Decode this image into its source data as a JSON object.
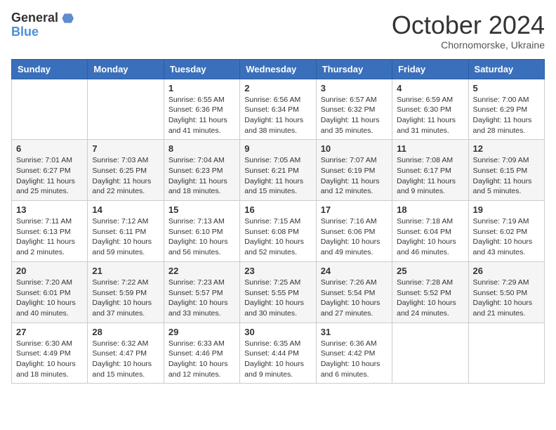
{
  "header": {
    "logo_general": "General",
    "logo_blue": "Blue",
    "month": "October 2024",
    "location": "Chornomorske, Ukraine"
  },
  "weekdays": [
    "Sunday",
    "Monday",
    "Tuesday",
    "Wednesday",
    "Thursday",
    "Friday",
    "Saturday"
  ],
  "weeks": [
    [
      null,
      null,
      {
        "day": "1",
        "sunrise": "6:55 AM",
        "sunset": "6:36 PM",
        "daylight": "11 hours and 41 minutes."
      },
      {
        "day": "2",
        "sunrise": "6:56 AM",
        "sunset": "6:34 PM",
        "daylight": "11 hours and 38 minutes."
      },
      {
        "day": "3",
        "sunrise": "6:57 AM",
        "sunset": "6:32 PM",
        "daylight": "11 hours and 35 minutes."
      },
      {
        "day": "4",
        "sunrise": "6:59 AM",
        "sunset": "6:30 PM",
        "daylight": "11 hours and 31 minutes."
      },
      {
        "day": "5",
        "sunrise": "7:00 AM",
        "sunset": "6:29 PM",
        "daylight": "11 hours and 28 minutes."
      }
    ],
    [
      {
        "day": "6",
        "sunrise": "7:01 AM",
        "sunset": "6:27 PM",
        "daylight": "11 hours and 25 minutes."
      },
      {
        "day": "7",
        "sunrise": "7:03 AM",
        "sunset": "6:25 PM",
        "daylight": "11 hours and 22 minutes."
      },
      {
        "day": "8",
        "sunrise": "7:04 AM",
        "sunset": "6:23 PM",
        "daylight": "11 hours and 18 minutes."
      },
      {
        "day": "9",
        "sunrise": "7:05 AM",
        "sunset": "6:21 PM",
        "daylight": "11 hours and 15 minutes."
      },
      {
        "day": "10",
        "sunrise": "7:07 AM",
        "sunset": "6:19 PM",
        "daylight": "11 hours and 12 minutes."
      },
      {
        "day": "11",
        "sunrise": "7:08 AM",
        "sunset": "6:17 PM",
        "daylight": "11 hours and 9 minutes."
      },
      {
        "day": "12",
        "sunrise": "7:09 AM",
        "sunset": "6:15 PM",
        "daylight": "11 hours and 5 minutes."
      }
    ],
    [
      {
        "day": "13",
        "sunrise": "7:11 AM",
        "sunset": "6:13 PM",
        "daylight": "11 hours and 2 minutes."
      },
      {
        "day": "14",
        "sunrise": "7:12 AM",
        "sunset": "6:11 PM",
        "daylight": "10 hours and 59 minutes."
      },
      {
        "day": "15",
        "sunrise": "7:13 AM",
        "sunset": "6:10 PM",
        "daylight": "10 hours and 56 minutes."
      },
      {
        "day": "16",
        "sunrise": "7:15 AM",
        "sunset": "6:08 PM",
        "daylight": "10 hours and 52 minutes."
      },
      {
        "day": "17",
        "sunrise": "7:16 AM",
        "sunset": "6:06 PM",
        "daylight": "10 hours and 49 minutes."
      },
      {
        "day": "18",
        "sunrise": "7:18 AM",
        "sunset": "6:04 PM",
        "daylight": "10 hours and 46 minutes."
      },
      {
        "day": "19",
        "sunrise": "7:19 AM",
        "sunset": "6:02 PM",
        "daylight": "10 hours and 43 minutes."
      }
    ],
    [
      {
        "day": "20",
        "sunrise": "7:20 AM",
        "sunset": "6:01 PM",
        "daylight": "10 hours and 40 minutes."
      },
      {
        "day": "21",
        "sunrise": "7:22 AM",
        "sunset": "5:59 PM",
        "daylight": "10 hours and 37 minutes."
      },
      {
        "day": "22",
        "sunrise": "7:23 AM",
        "sunset": "5:57 PM",
        "daylight": "10 hours and 33 minutes."
      },
      {
        "day": "23",
        "sunrise": "7:25 AM",
        "sunset": "5:55 PM",
        "daylight": "10 hours and 30 minutes."
      },
      {
        "day": "24",
        "sunrise": "7:26 AM",
        "sunset": "5:54 PM",
        "daylight": "10 hours and 27 minutes."
      },
      {
        "day": "25",
        "sunrise": "7:28 AM",
        "sunset": "5:52 PM",
        "daylight": "10 hours and 24 minutes."
      },
      {
        "day": "26",
        "sunrise": "7:29 AM",
        "sunset": "5:50 PM",
        "daylight": "10 hours and 21 minutes."
      }
    ],
    [
      {
        "day": "27",
        "sunrise": "6:30 AM",
        "sunset": "4:49 PM",
        "daylight": "10 hours and 18 minutes."
      },
      {
        "day": "28",
        "sunrise": "6:32 AM",
        "sunset": "4:47 PM",
        "daylight": "10 hours and 15 minutes."
      },
      {
        "day": "29",
        "sunrise": "6:33 AM",
        "sunset": "4:46 PM",
        "daylight": "10 hours and 12 minutes."
      },
      {
        "day": "30",
        "sunrise": "6:35 AM",
        "sunset": "4:44 PM",
        "daylight": "10 hours and 9 minutes."
      },
      {
        "day": "31",
        "sunrise": "6:36 AM",
        "sunset": "4:42 PM",
        "daylight": "10 hours and 6 minutes."
      },
      null,
      null
    ]
  ]
}
